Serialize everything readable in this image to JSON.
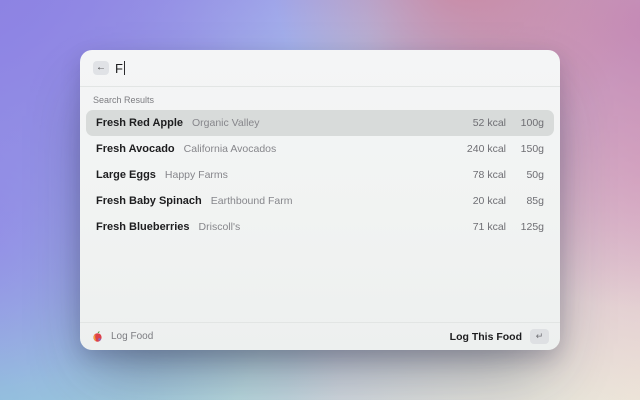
{
  "search": {
    "query": "F",
    "back_icon": "←"
  },
  "results_header": "Search Results",
  "results": [
    {
      "name": "Fresh Red Apple",
      "brand": "Organic Valley",
      "kcal": "52 kcal",
      "weight": "100g",
      "selected": true
    },
    {
      "name": "Fresh Avocado",
      "brand": "California Avocados",
      "kcal": "240 kcal",
      "weight": "150g",
      "selected": false
    },
    {
      "name": "Large Eggs",
      "brand": "Happy Farms",
      "kcal": "78 kcal",
      "weight": "50g",
      "selected": false
    },
    {
      "name": "Fresh Baby Spinach",
      "brand": "Earthbound Farm",
      "kcal": "20 kcal",
      "weight": "85g",
      "selected": false
    },
    {
      "name": "Fresh Blueberries",
      "brand": "Driscoll's",
      "kcal": "71 kcal",
      "weight": "125g",
      "selected": false
    }
  ],
  "footer": {
    "context_label": "Log Food",
    "primary_action": "Log This Food",
    "key_hint": "↵"
  },
  "colors": {
    "selection_bg": "#d8dbda",
    "window_bg": "#f2f4f3",
    "apple_red": "#dd4048",
    "apple_orange": "#f2a33a",
    "leaf_green": "#4f9e3f"
  }
}
